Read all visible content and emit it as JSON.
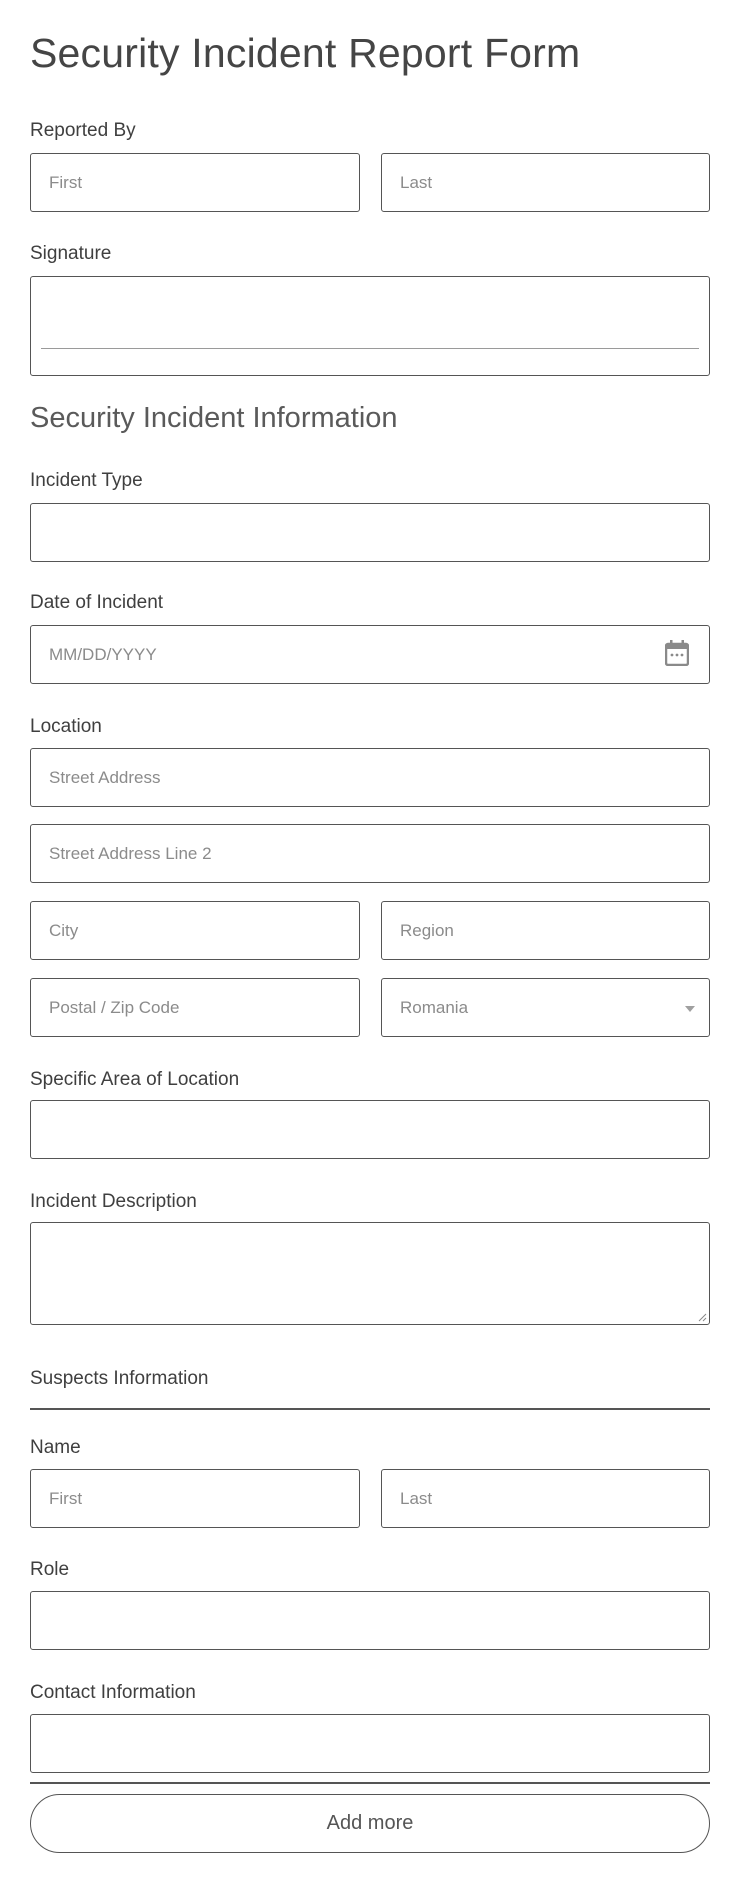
{
  "form": {
    "title": "Security Incident Report Form"
  },
  "reported_by": {
    "label": "Reported By",
    "first_placeholder": "First",
    "last_placeholder": "Last"
  },
  "signature": {
    "label": "Signature"
  },
  "incident_section": {
    "heading": "Security Incident Information",
    "incident_type": {
      "label": "Incident Type",
      "value": ""
    },
    "date": {
      "label": "Date of Incident",
      "placeholder": "MM/DD/YYYY",
      "icon": "calendar-icon"
    },
    "location": {
      "label": "Location",
      "street_placeholder": "Street Address",
      "street2_placeholder": "Street Address Line 2",
      "city_placeholder": "City",
      "region_placeholder": "Region",
      "postal_placeholder": "Postal / Zip Code",
      "country_selected": "Romania",
      "country_icon": "chevron-down-icon"
    },
    "specific_area": {
      "label": "Specific Area of Location",
      "value": ""
    },
    "description": {
      "label": "Incident Description",
      "value": ""
    }
  },
  "suspects": {
    "heading": "Suspects Information",
    "name": {
      "label": "Name",
      "first_placeholder": "First",
      "last_placeholder": "Last"
    },
    "role": {
      "label": "Role",
      "value": ""
    },
    "contact": {
      "label": "Contact Information",
      "value": ""
    },
    "add_more_label": "Add more"
  }
}
